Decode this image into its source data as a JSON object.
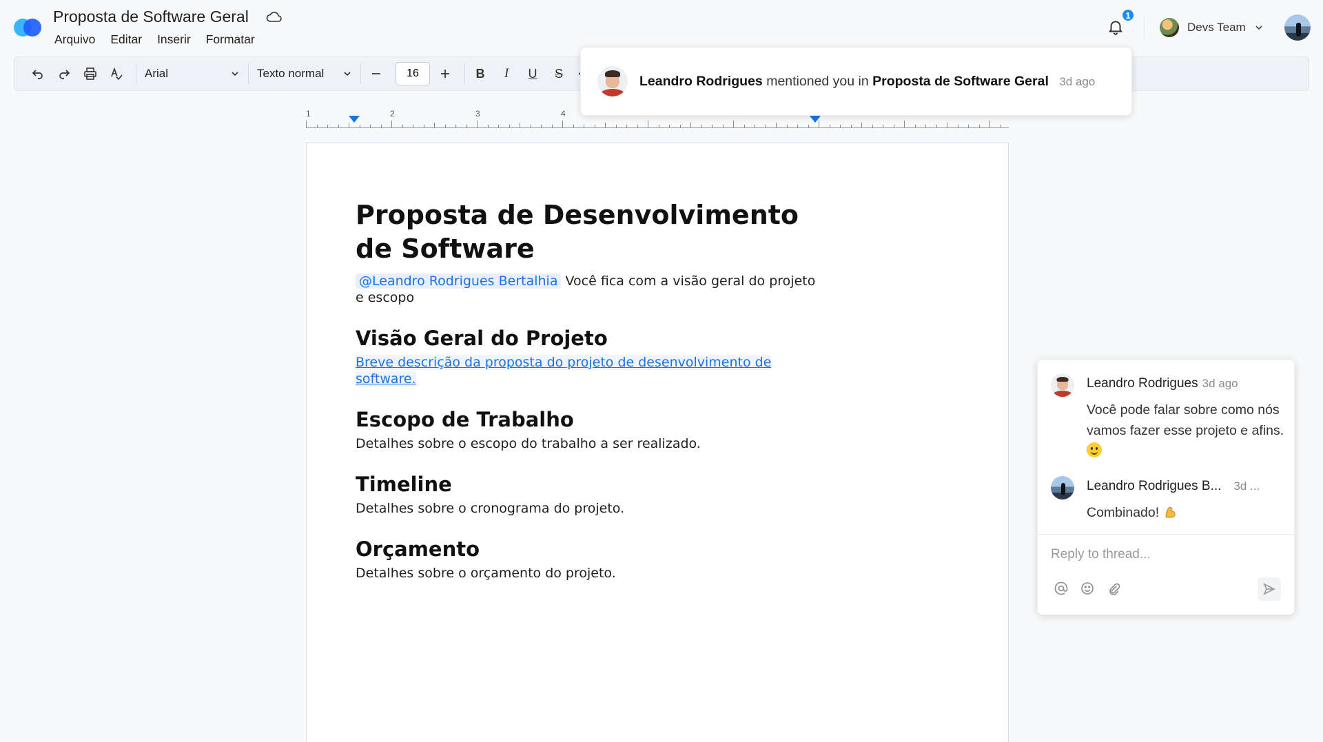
{
  "app": {
    "document_title": "Proposta de Software Geral",
    "menu": [
      "Arquivo",
      "Editar",
      "Inserir",
      "Formatar"
    ]
  },
  "header": {
    "notification_count": "1",
    "team_name": "Devs Team"
  },
  "toolbar": {
    "font_family": "Arial",
    "text_style": "Texto normal",
    "font_size": "16",
    "bold_label": "B",
    "italic_label": "I",
    "underline_label": "U",
    "strike_label": "S"
  },
  "ruler": {
    "numbers": [
      "1",
      "2",
      "3",
      "4"
    ]
  },
  "document": {
    "heading": "Proposta de Desenvolvimento de Software",
    "mention": "@Leandro Rodrigues Bertalhia",
    "mention_text": " Você fica com a visão geral do projeto e escopo",
    "sections": [
      {
        "title": "Visão Geral do Projeto",
        "body": "Breve descrição da proposta do projeto de desenvolvimento de software."
      },
      {
        "title": "Escopo de Trabalho",
        "body": "Detalhes sobre o escopo do trabalho a ser realizado."
      },
      {
        "title": "Timeline",
        "body": "Detalhes sobre o cronograma do projeto."
      },
      {
        "title": "Orçamento",
        "body": "Detalhes sobre o orçamento do projeto."
      }
    ]
  },
  "notification": {
    "user": "Leandro Rodrigues",
    "action": " mentioned you in ",
    "target": "Proposta de Software Geral",
    "time": "3d ago"
  },
  "comments": {
    "thread": [
      {
        "author": "Leandro Rodrigues",
        "time": "3d ago",
        "text": "Você pode falar sobre como nós vamos fazer esse projeto e afins."
      },
      {
        "author": "Leandro Rodrigues B...",
        "time": "3d ...",
        "text": "Combinado!"
      }
    ],
    "reply_placeholder": "Reply to thread..."
  },
  "colors": {
    "accent": "#1a73e8",
    "badge": "#1a8cff",
    "mention_bg": "#e8f0fe"
  }
}
